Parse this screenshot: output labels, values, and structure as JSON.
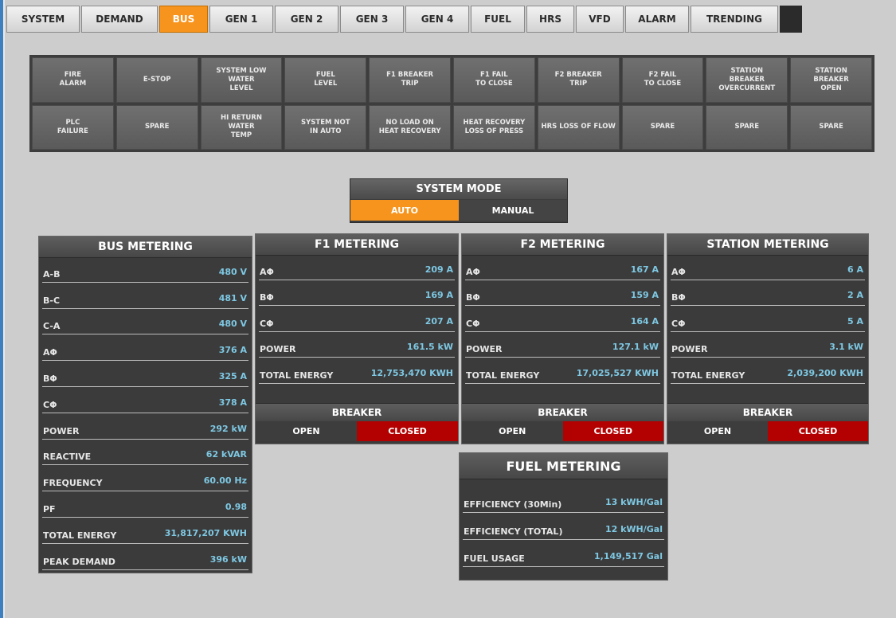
{
  "nav": {
    "tabs": [
      {
        "label": "SYSTEM",
        "active": false
      },
      {
        "label": "DEMAND",
        "active": false
      },
      {
        "label": "BUS",
        "active": true
      },
      {
        "label": "GEN 1",
        "active": false
      },
      {
        "label": "GEN 2",
        "active": false
      },
      {
        "label": "GEN 3",
        "active": false
      },
      {
        "label": "GEN 4",
        "active": false
      },
      {
        "label": "FUEL",
        "active": false
      },
      {
        "label": "HRS",
        "active": false
      },
      {
        "label": "VFD",
        "active": false
      },
      {
        "label": "ALARM",
        "active": false
      },
      {
        "label": "TRENDING",
        "active": false
      }
    ]
  },
  "alarms": [
    "FIRE\nALARM",
    "E-STOP",
    "SYSTEM LOW\nWATER\nLEVEL",
    "FUEL\nLEVEL",
    "F1 BREAKER\nTRIP",
    "F1 FAIL\nTO CLOSE",
    "F2 BREAKER\nTRIP",
    "F2 FAIL\nTO CLOSE",
    "STATION\nBREAKER\nOVERCURRENT",
    "STATION\nBREAKER\nOPEN",
    "PLC\nFAILURE",
    "SPARE",
    "HI RETURN\nWATER\nTEMP",
    "SYSTEM NOT\nIN AUTO",
    "NO LOAD ON\nHEAT RECOVERY",
    "HEAT RECOVERY\nLOSS OF PRESS",
    "HRS LOSS OF FLOW",
    "SPARE",
    "SPARE",
    "SPARE"
  ],
  "system_mode": {
    "title": "SYSTEM MODE",
    "auto": "AUTO",
    "manual": "MANUAL"
  },
  "bus": {
    "title": "BUS METERING",
    "rows": [
      {
        "label": "A-B",
        "value": "480 V"
      },
      {
        "label": "B-C",
        "value": "481 V"
      },
      {
        "label": "C-A",
        "value": "480 V"
      },
      {
        "label": "AΦ",
        "value": "376 A"
      },
      {
        "label": "BΦ",
        "value": "325 A"
      },
      {
        "label": "CΦ",
        "value": "378 A"
      },
      {
        "label": "POWER",
        "value": "292 kW"
      },
      {
        "label": "REACTIVE",
        "value": "62 kVAR"
      },
      {
        "label": "FREQUENCY",
        "value": "60.00 Hz"
      },
      {
        "label": "PF",
        "value": "0.98"
      },
      {
        "label": "TOTAL ENERGY",
        "value": "31,817,207 KWH"
      },
      {
        "label": "PEAK DEMAND",
        "value": "396 kW"
      }
    ]
  },
  "f1": {
    "title": "F1 METERING",
    "rows": [
      {
        "label": "AΦ",
        "value": "209 A"
      },
      {
        "label": "BΦ",
        "value": "169 A"
      },
      {
        "label": "CΦ",
        "value": "207 A"
      },
      {
        "label": "POWER",
        "value": "161.5 kW"
      },
      {
        "label": "TOTAL ENERGY",
        "value": "12,753,470 KWH"
      }
    ],
    "breaker": {
      "title": "BREAKER",
      "open": "OPEN",
      "closed": "CLOSED"
    }
  },
  "f2": {
    "title": "F2 METERING",
    "rows": [
      {
        "label": "AΦ",
        "value": "167 A"
      },
      {
        "label": "BΦ",
        "value": "159 A"
      },
      {
        "label": "CΦ",
        "value": "164 A"
      },
      {
        "label": "POWER",
        "value": "127.1 kW"
      },
      {
        "label": "TOTAL ENERGY",
        "value": "17,025,527 KWH"
      }
    ],
    "breaker": {
      "title": "BREAKER",
      "open": "OPEN",
      "closed": "CLOSED"
    }
  },
  "station": {
    "title": "STATION METERING",
    "rows": [
      {
        "label": "AΦ",
        "value": "6 A"
      },
      {
        "label": "BΦ",
        "value": "2 A"
      },
      {
        "label": "CΦ",
        "value": "5 A"
      },
      {
        "label": "POWER",
        "value": "3.1 kW"
      },
      {
        "label": "TOTAL ENERGY",
        "value": "2,039,200 KWH"
      }
    ],
    "breaker": {
      "title": "BREAKER",
      "open": "OPEN",
      "closed": "CLOSED"
    }
  },
  "fuel": {
    "title": "FUEL METERING",
    "rows": [
      {
        "label": "EFFICIENCY (30Min)",
        "value": "13 kWH/Gal"
      },
      {
        "label": "EFFICIENCY (TOTAL)",
        "value": "12 kWH/Gal"
      },
      {
        "label": "FUEL USAGE",
        "value": "1,149,517 Gal"
      }
    ]
  },
  "colors": {
    "accent": "#f7941d",
    "closed": "#b30000",
    "value_text": "#7ec8e3",
    "panel_bg": "#3b3b3b"
  }
}
